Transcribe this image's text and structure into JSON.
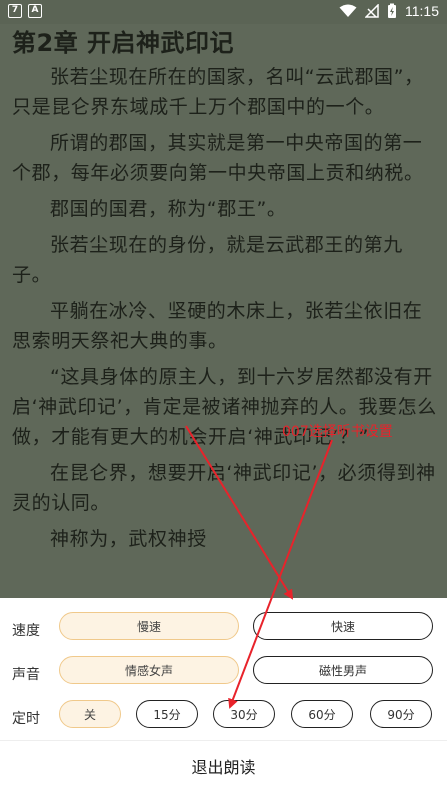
{
  "statusbar": {
    "icon_left_1": "7",
    "icon_left_2": "A",
    "time": "11:15",
    "battery_glyph": "⚡"
  },
  "reader": {
    "chapter_title": "第2章 开启神武印记",
    "paragraphs": [
      "张若尘现在所在的国家，名叫“云武郡国”，只是昆仑界东域成千上万个郡国中的一个。",
      "所谓的郡国，其实就是第一中央帝国的第一个郡，每年必须要向第一中央帝国上贡和纳税。",
      "郡国的国君，称为“郡王”。",
      "张若尘现在的身份，就是云武郡王的第九子。",
      "平躺在冰冷、坚硬的木床上，张若尘依旧在思索明天祭祀大典的事。",
      "“这具身体的原主人，到十六岁居然都没有开启‘神武印记’，肯定是被诸神抛弃的人。我要怎么做，才能有更大的机会开启‘神武印记’？”",
      "在昆仑界，想要开启‘神武印记’，必须得到神灵的认同。",
      "神称为，武权神授"
    ]
  },
  "annotation": {
    "label": "007选择听书设置",
    "color": "#e8232b"
  },
  "settings": {
    "speed": {
      "label": "速度",
      "options": [
        "慢速",
        "快速"
      ],
      "selected": "慢速"
    },
    "voice": {
      "label": "声音",
      "options": [
        "情感女声",
        "磁性男声"
      ],
      "selected": "情感女声"
    },
    "timer": {
      "label": "定时",
      "options": [
        "关",
        "15分",
        "30分",
        "60分",
        "90分"
      ],
      "selected": "关"
    },
    "exit_label": "退出朗读",
    "accent_fill": "#fdf3e3",
    "accent_border": "#f0c98b"
  }
}
